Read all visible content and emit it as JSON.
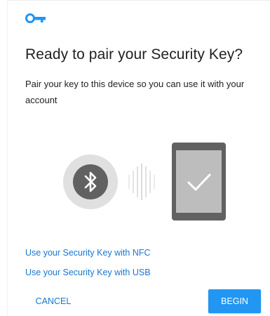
{
  "header": {
    "icon": "key-icon",
    "accent_color": "#2196f3"
  },
  "dialog": {
    "title": "Ready to pair your Security Key?",
    "description": "Pair your key to this device so you can use it with your account"
  },
  "illustration": {
    "bluetooth_icon": "bluetooth-icon",
    "signal_icon": "signal-waves-icon",
    "device_icon": "tablet-icon",
    "check_icon": "checkmark-icon"
  },
  "links": {
    "nfc": "Use your Security Key with NFC",
    "usb": "Use your Security Key with USB"
  },
  "actions": {
    "cancel_label": "CANCEL",
    "begin_label": "BEGIN",
    "link_color": "#1976d2",
    "primary_color": "#2196f3"
  }
}
